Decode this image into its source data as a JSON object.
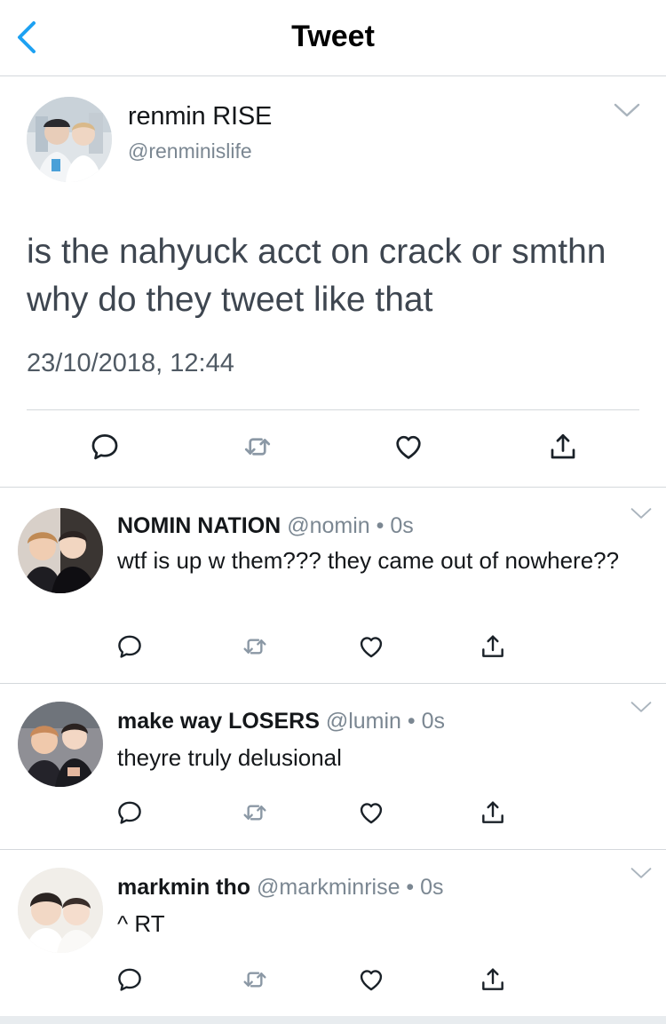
{
  "nav": {
    "title": "Tweet"
  },
  "main": {
    "name": "renmin RISE",
    "handle": "@renminislife",
    "text": "is the nahyuck acct on crack or smthn why do they tweet like that",
    "timestamp": "23/10/2018, 12:44"
  },
  "replies": [
    {
      "name": "NOMIN NATION",
      "meta": "@nomin • 0s",
      "text": "wtf is up w them??? they came out of nowhere??"
    },
    {
      "name": "make way LOSERS",
      "meta": "@lumin • 0s",
      "text": "theyre truly delusional"
    },
    {
      "name": "markmin tho",
      "meta": "@markminrise • 0s",
      "text": "^ RT"
    }
  ],
  "colors": {
    "accent": "#1da1f2",
    "icon_gray": "#657786",
    "separator": "#d4d8dc"
  },
  "icons": [
    "back-chevron-icon",
    "caret-down-icon",
    "reply-icon",
    "retweet-icon",
    "like-icon",
    "share-icon"
  ]
}
